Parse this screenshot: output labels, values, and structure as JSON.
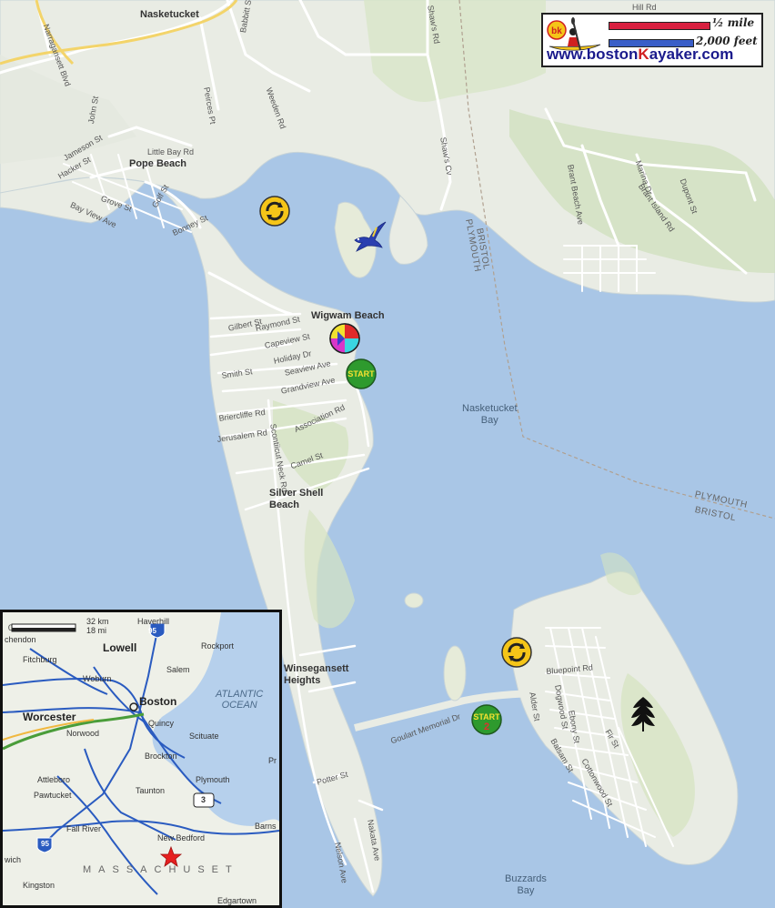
{
  "legend": {
    "half_mile": "½ mile",
    "feet": "2,000 feet",
    "brand_1": "www.boston",
    "brand_k": "K",
    "brand_2": "ayaker.com",
    "logo_text": "bk",
    "bar_mile_color": "#d82040",
    "bar_feet_color": "#3a5ec8"
  },
  "streets": {
    "nasketucket": "Nasketucket",
    "narragansett": "Narragansett Blvd",
    "peirces": "Peirces Pt",
    "weeden": "Weeden Rd",
    "babbitt": "Babbitt St",
    "shaws_rd": "Shaw's Rd",
    "shaws_cv": "Shaw's Cv",
    "john": "John St",
    "jameson": "Jameson St",
    "hacker": "Hacker St",
    "little_bay": "Little Bay Rd",
    "grove": "Grove St",
    "golf": "Golf St",
    "bay_view": "Bay View Ave",
    "bonney": "Bonney St",
    "gilbert": "Gilbert St",
    "raymond": "Raymond St",
    "capeview": "Capeview St",
    "holiday": "Holiday Dr",
    "seaview": "Seaview Ave",
    "smith": "Smith St",
    "grandview": "Grandview Ave",
    "briercliffe": "Briercliffe Rd",
    "jerusalem": "Jerusalem Rd",
    "association": "Association Rd",
    "scontiicut": "Scontiicut Neck Rd",
    "camel": "Camel St",
    "brant_beach": "Brant Beach Ave",
    "marina": "Marina Dr",
    "brant_island": "Brant Island Rd",
    "dupont": "Dupont St",
    "goulart": "Goulart Memorial Dr",
    "bluepoint": "Bluepoint Rd",
    "alder": "Alder St",
    "dogwood": "Dogwood St",
    "ebony": "Ebony St",
    "balsam": "Balsam St",
    "cottonwood": "Cottonwood St",
    "fir": "Fir St",
    "potter": "Potter St",
    "nelson": "Nelson Ave",
    "nakata": "Nakata Ave",
    "hill": "Hill Rd"
  },
  "places": {
    "pope_beach": "Pope Beach",
    "wigwam_beach": "Wigwam Beach",
    "silver_shell_1": "Silver Shell",
    "silver_shell_2": "Beach",
    "sconticut_heights_1": "Winsegansett",
    "sconticut_heights_2": "Heights"
  },
  "water": {
    "nasketucket_bay_1": "Nasketucket",
    "nasketucket_bay_2": "Bay",
    "buzzards_bay_1": "Buzzards",
    "buzzards_bay_2": "Bay"
  },
  "boundary": {
    "plymouth": "PLYMOUTH",
    "bristol": "BRISTOL"
  },
  "markers": {
    "start_1": "START",
    "start_2": "START",
    "start_2_num": "2"
  },
  "inset": {
    "scale_km": "32 km",
    "scale_mi": "18 mi",
    "scale_zero": "0",
    "haverhill": "Haverhill",
    "lowell": "Lowell",
    "fitchburg": "Fitchburg",
    "rockport": "Rockport",
    "woburn": "Woburn",
    "salem": "Salem",
    "atlantic_ocean_1": "ATLANTIC",
    "atlantic_ocean_2": "OCEAN",
    "worcester": "Worcester",
    "boston": "Boston",
    "quincy": "Quincy",
    "norwood": "Norwood",
    "scituate": "Scituate",
    "brockton": "Brockton",
    "plymouth": "Plymouth",
    "attleboro": "Attleboro",
    "taunton": "Taunton",
    "pawtucket": "Pawtucket",
    "fall_river": "Fall River",
    "new_bedford": "New Bedford",
    "kingston": "Kingston",
    "massachusetts": "MASSACHUSET",
    "edgartown": "Edgartown",
    "barnstable": "Barns",
    "greenwich": "wich",
    "winchendon": "chendon",
    "highway_95_n": "95",
    "highway_95_s": "95",
    "highway_3": "3",
    "pr": "Pr"
  }
}
